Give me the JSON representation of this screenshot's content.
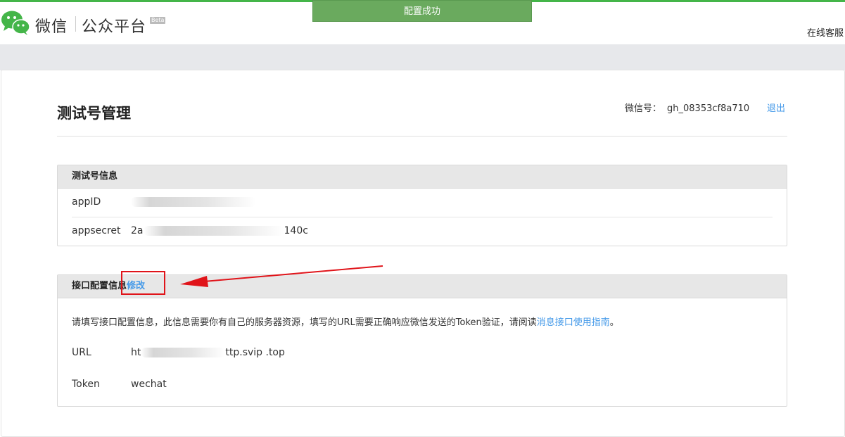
{
  "header": {
    "brand_left": "微信",
    "brand_right": "公众平台",
    "beta": "Beta",
    "online_service": "在线客服"
  },
  "toast": "配置成功",
  "page": {
    "title": "测试号管理",
    "account_label": "微信号：",
    "account_value": "gh_08353cf8a710",
    "logout": "退出"
  },
  "test_info": {
    "heading": "测试号信息",
    "appid_label": "appID",
    "appsecret_label": "appsecret",
    "appsecret_value_prefix": "2a",
    "appsecret_value_suffix": "140c"
  },
  "interface": {
    "heading": "接口配置信息",
    "edit": "修改",
    "desc_text": "请填写接口配置信息，此信息需要你有自己的服务器资源，填写的URL需要正确响应微信发送的Token验证，请阅读",
    "desc_link": "消息接口使用指南",
    "desc_end": "。",
    "url_label": "URL",
    "url_prefix": "ht",
    "url_suffix": "ttp.svip  .top",
    "token_label": "Token",
    "token_value": "wechat"
  },
  "colors": {
    "accent_green": "#44b549",
    "toast_green": "#6aaa5e",
    "link_blue": "#459ae9",
    "annotation_red": "#e0141a"
  },
  "icons": {
    "logo": "wechat-logo-icon",
    "arrow": "red-arrow-annotation"
  }
}
